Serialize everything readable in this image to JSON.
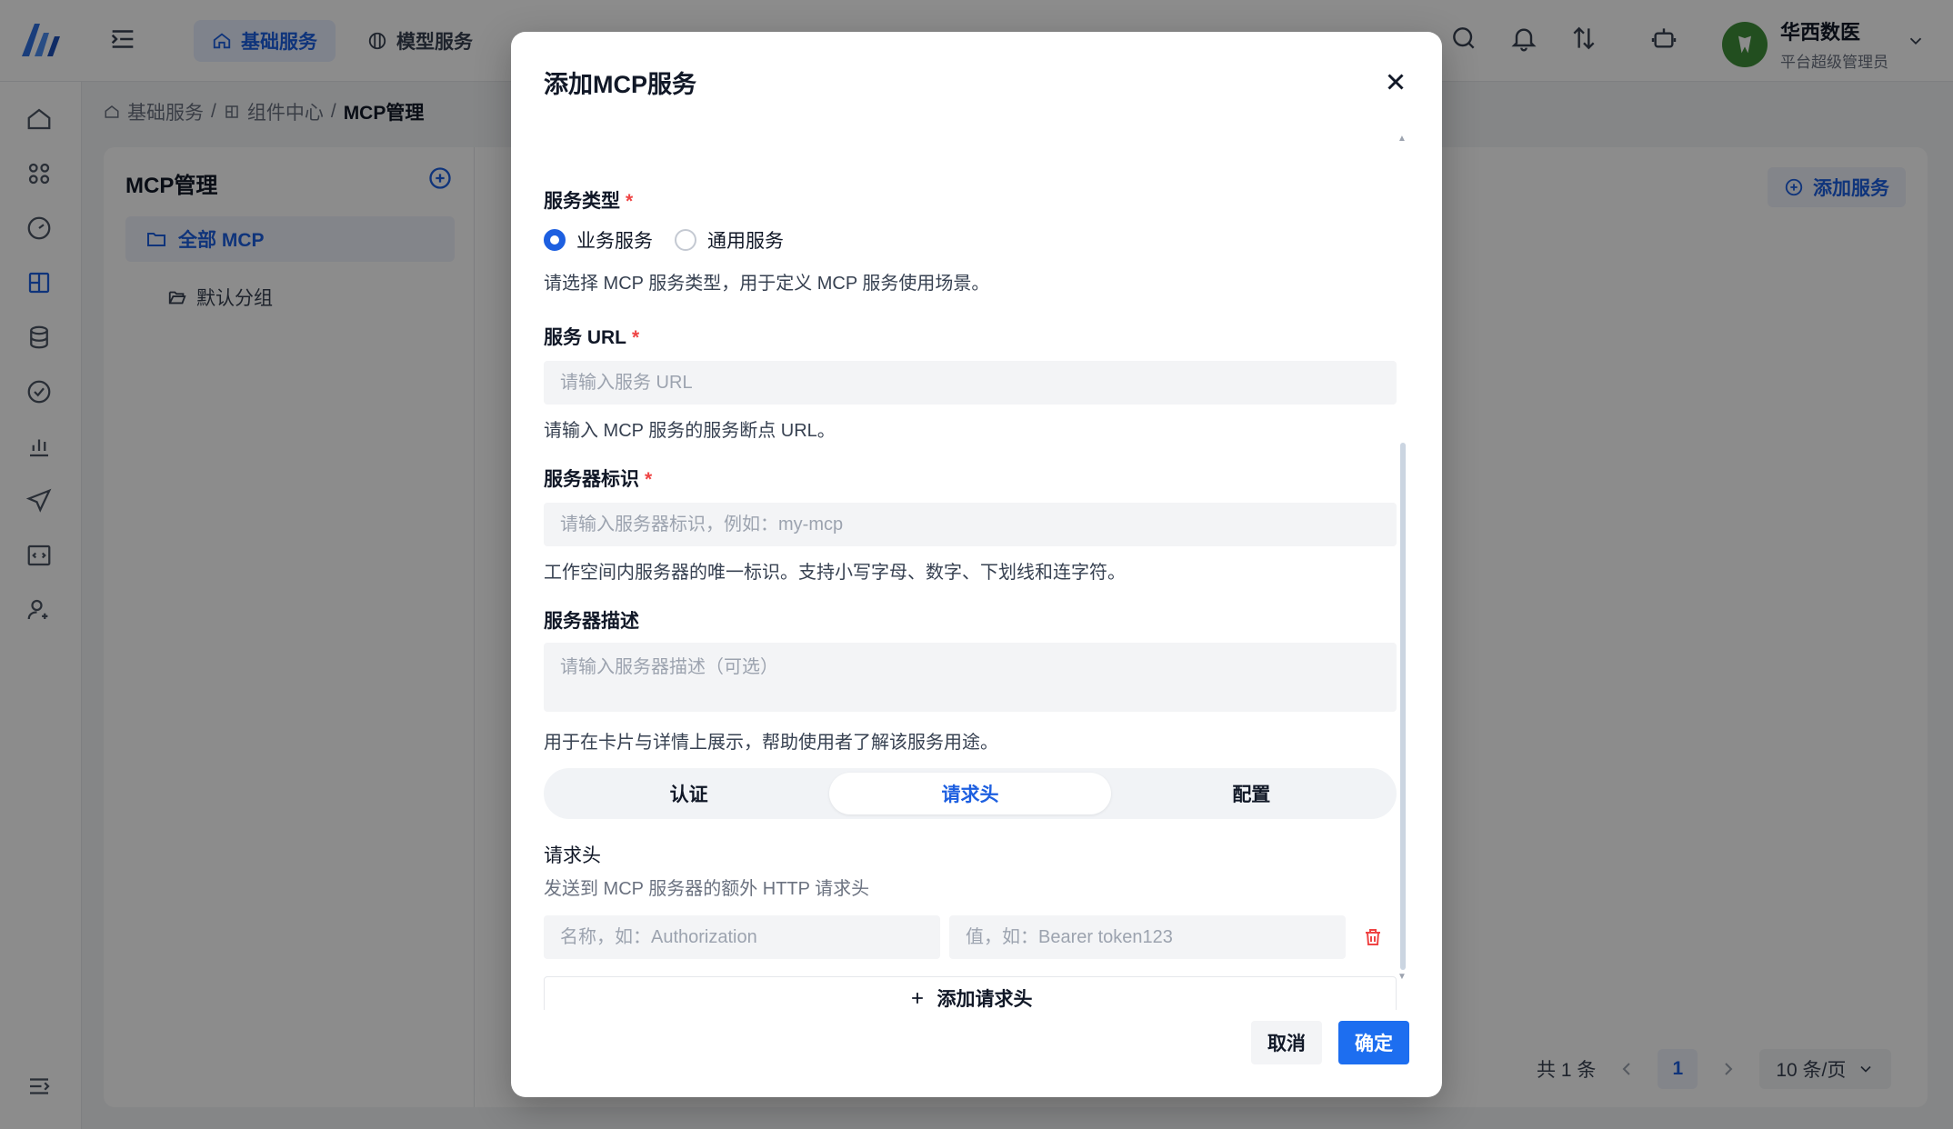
{
  "header": {
    "nav_tabs": [
      {
        "label": "基础服务",
        "icon": "home-icon"
      },
      {
        "label": "模型服务",
        "icon": "model-icon"
      }
    ],
    "user": {
      "name": "华西数医",
      "role": "平台超级管理员"
    }
  },
  "breadcrumb": [
    "基础服务",
    "组件中心",
    "MCP管理"
  ],
  "left_pane": {
    "title": "MCP管理",
    "tree": [
      {
        "label": "全部 MCP",
        "selected": true
      },
      {
        "label": "默认分组",
        "selected": false
      }
    ]
  },
  "main": {
    "add_service_label": "添加服务",
    "pagination": {
      "total_text": "共 1 条",
      "current_page": "1",
      "page_size": "10 条/页"
    }
  },
  "modal": {
    "title": "添加MCP服务",
    "service_type": {
      "label": "服务类型",
      "options": [
        "业务服务",
        "通用服务"
      ],
      "selected": "业务服务",
      "help": "请选择 MCP 服务类型，用于定义 MCP 服务使用场景。"
    },
    "service_url": {
      "label": "服务 URL",
      "placeholder": "请输入服务 URL",
      "value": "",
      "help": "请输入 MCP 服务的服务断点 URL。"
    },
    "server_id": {
      "label": "服务器标识",
      "placeholder": "请输入服务器标识，例如：my-mcp",
      "value": "",
      "help": "工作空间内服务器的唯一标识。支持小写字母、数字、下划线和连字符。"
    },
    "server_desc": {
      "label": "服务器描述",
      "placeholder": "请输入服务器描述（可选）",
      "value": "",
      "help": "用于在卡片与详情上展示，帮助使用者了解该服务用途。"
    },
    "tabs": [
      {
        "label": "认证",
        "active": false
      },
      {
        "label": "请求头",
        "active": true
      },
      {
        "label": "配置",
        "active": false
      }
    ],
    "headers_section": {
      "title": "请求头",
      "desc": "发送到 MCP 服务器的额外 HTTP 请求头",
      "rows": [
        {
          "name_placeholder": "名称，如：Authorization",
          "value_placeholder": "值，如：Bearer token123"
        }
      ],
      "add_label": "添加请求头"
    },
    "cancel_label": "取消",
    "ok_label": "确定"
  },
  "colors": {
    "accent": "#1d5fe0",
    "danger": "#ef4444",
    "primary_button": "#1d6ef0"
  }
}
